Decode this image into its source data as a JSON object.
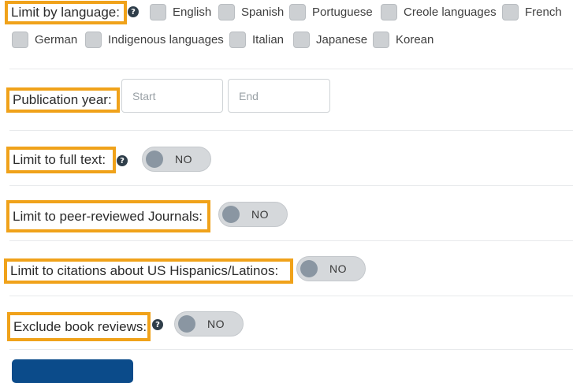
{
  "language": {
    "label": "Limit by language:",
    "help_icon": "question-circle-icon",
    "help_glyph": "?",
    "options": [
      "English",
      "Spanish",
      "Portuguese",
      "Creole languages",
      "French",
      "German",
      "Indigenous languages",
      "Italian",
      "Japanese",
      "Korean"
    ]
  },
  "publication_year": {
    "label": "Publication year:",
    "start_placeholder": "Start",
    "end_placeholder": "End"
  },
  "full_text": {
    "label": "Limit to full text:",
    "help_icon": "question-circle-icon",
    "help_glyph": "?",
    "toggle": "NO"
  },
  "peer_reviewed": {
    "label": "Limit to peer-reviewed Journals:",
    "toggle": "NO"
  },
  "us_hispanics": {
    "label": "Limit to citations about US Hispanics/Latinos:",
    "toggle": "NO"
  },
  "book_reviews": {
    "label": "Exclude book reviews:",
    "help_icon": "question-circle-icon",
    "help_glyph": "?",
    "toggle": "NO"
  },
  "colors": {
    "highlight": "#f0a21a",
    "submit_button": "#0b4b8a",
    "toggle_off": "#d5d8db"
  }
}
